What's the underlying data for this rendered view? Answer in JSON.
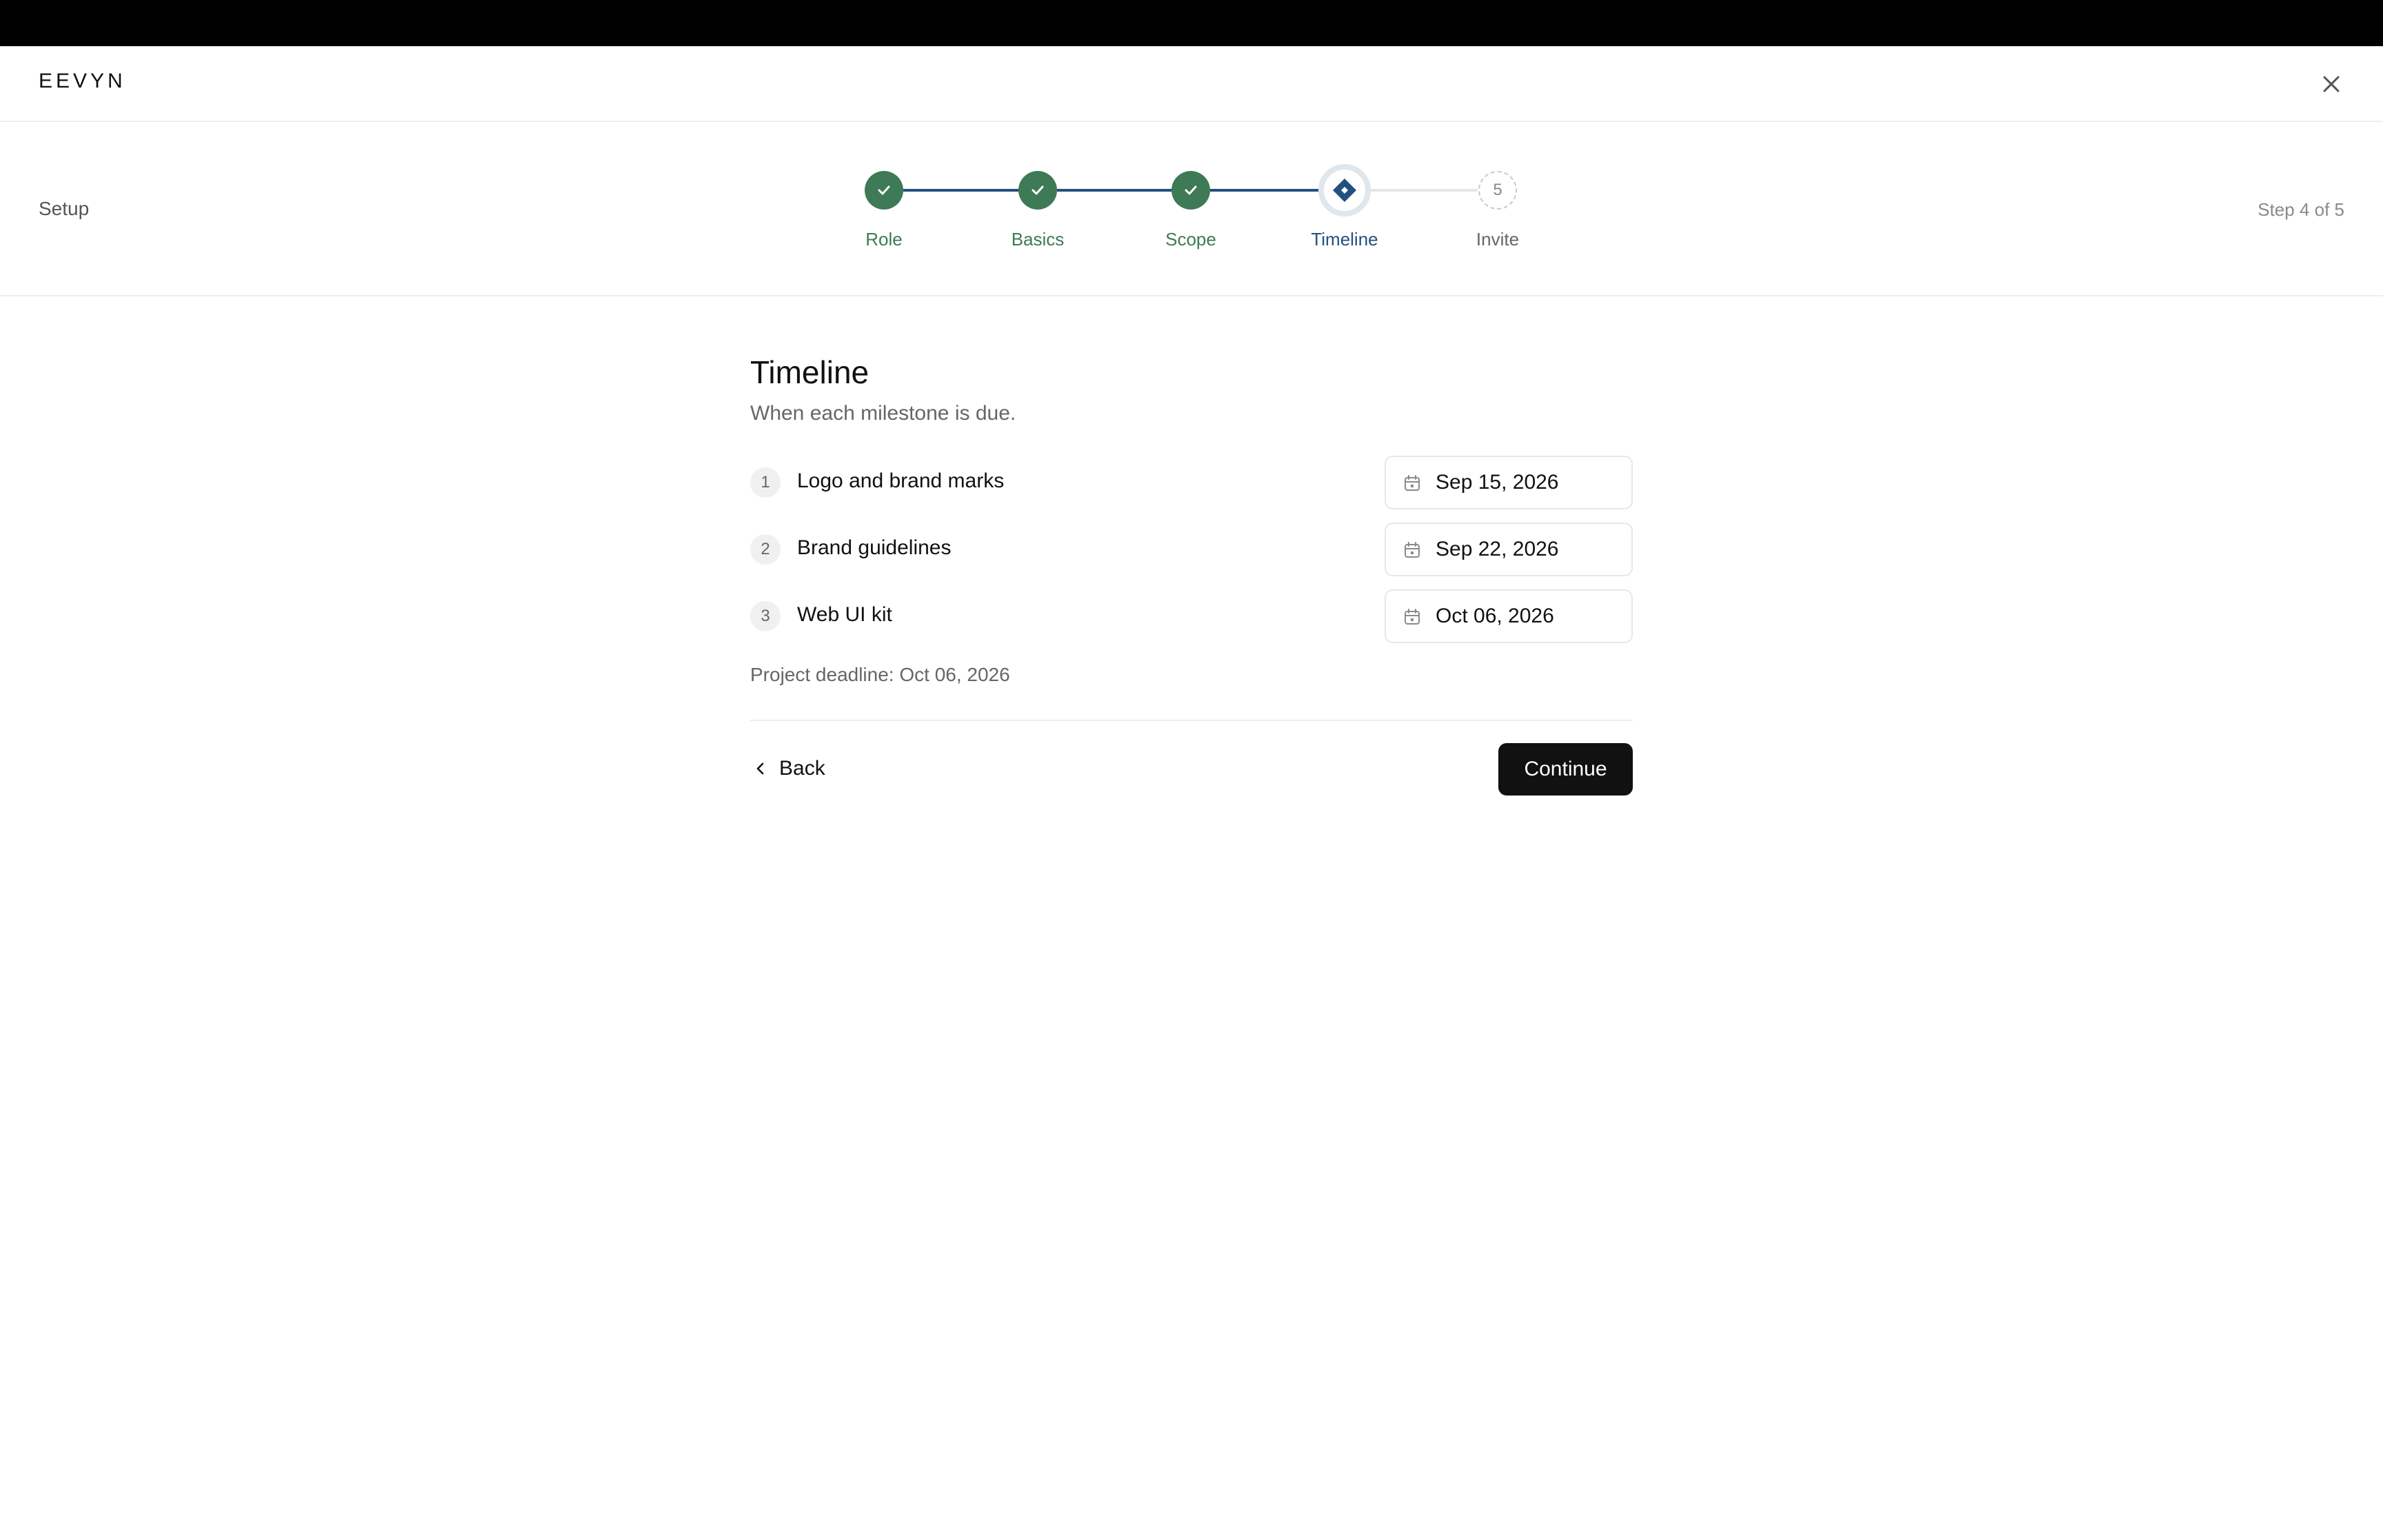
{
  "header": {
    "brand": "EEVYN",
    "close_icon": "close-icon"
  },
  "stepper": {
    "section_label": "Setup",
    "step_counter": "Step 4 of 5",
    "steps": [
      {
        "label": "Role",
        "status": "complete",
        "icon": "check-icon"
      },
      {
        "label": "Basics",
        "status": "complete",
        "icon": "check-icon"
      },
      {
        "label": "Scope",
        "status": "complete",
        "icon": "check-icon"
      },
      {
        "label": "Timeline",
        "status": "current",
        "icon": "diamond-icon"
      },
      {
        "label": "Invite",
        "status": "upcoming",
        "number": "5"
      }
    ]
  },
  "main": {
    "title": "Timeline",
    "subtitle": "When each milestone is due.",
    "milestones": [
      {
        "number": "1",
        "name": "Logo and brand marks",
        "date": "Sep 15, 2026"
      },
      {
        "number": "2",
        "name": "Brand guidelines",
        "date": "Sep 22, 2026"
      },
      {
        "number": "3",
        "name": "Web UI kit",
        "date": "Oct 06, 2026"
      }
    ],
    "deadline": "Project deadline: Oct 06, 2026"
  },
  "footer": {
    "back_label": "Back",
    "continue_label": "Continue"
  },
  "colors": {
    "complete": "#3d7a55",
    "current": "#23507f",
    "progress_line": "#23507f",
    "upcoming_line": "#e6e6e6",
    "primary_button": "#111111"
  }
}
